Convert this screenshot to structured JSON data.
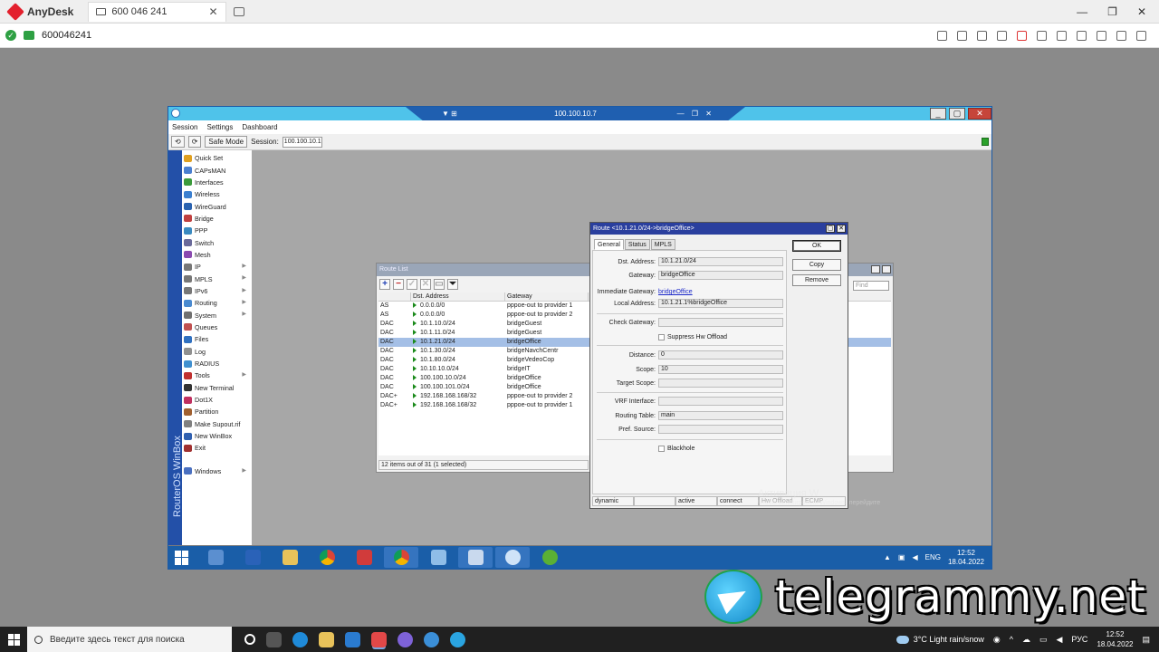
{
  "anydesk": {
    "app_name": "AnyDesk",
    "tab_id": "600 046 241",
    "address_id": "600046241",
    "close_glyph": "✕",
    "win_min": "—",
    "win_max": "❐",
    "win_close": "✕"
  },
  "winbox": {
    "title_ip": "100.100.10.7",
    "menu": [
      "Session",
      "Settings",
      "Dashboard"
    ],
    "toolbar": {
      "safe_mode": "Safe Mode",
      "session_label": "Session:",
      "session_value": "100.100.10.1"
    },
    "brand": "RouterOS WinBox",
    "nav": [
      {
        "label": "Quick Set",
        "color": "#e0a020"
      },
      {
        "label": "CAPsMAN",
        "color": "#4a7fd0"
      },
      {
        "label": "Interfaces",
        "color": "#3b9a3b"
      },
      {
        "label": "Wireless",
        "color": "#3b7fd0"
      },
      {
        "label": "WireGuard",
        "color": "#2a62b0"
      },
      {
        "label": "Bridge",
        "color": "#c04040"
      },
      {
        "label": "PPP",
        "color": "#3a8ac0"
      },
      {
        "label": "Switch",
        "color": "#6a6a9a"
      },
      {
        "label": "Mesh",
        "color": "#8a4ab0"
      },
      {
        "label": "IP",
        "color": "#777777",
        "sub": true
      },
      {
        "label": "MPLS",
        "color": "#777777",
        "sub": true
      },
      {
        "label": "IPv6",
        "color": "#777777",
        "sub": true
      },
      {
        "label": "Routing",
        "color": "#4a8ad0",
        "sub": true
      },
      {
        "label": "System",
        "color": "#707070",
        "sub": true
      },
      {
        "label": "Queues",
        "color": "#c05050"
      },
      {
        "label": "Files",
        "color": "#3070c0"
      },
      {
        "label": "Log",
        "color": "#909090"
      },
      {
        "label": "RADIUS",
        "color": "#4090d0"
      },
      {
        "label": "Tools",
        "color": "#c03030",
        "sub": true
      },
      {
        "label": "New Terminal",
        "color": "#333333"
      },
      {
        "label": "Dot1X",
        "color": "#c03060"
      },
      {
        "label": "Partition",
        "color": "#a06030"
      },
      {
        "label": "Make Supout.rif",
        "color": "#808080"
      },
      {
        "label": "New WinBox",
        "color": "#3060b0"
      },
      {
        "label": "Exit",
        "color": "#a03030"
      }
    ],
    "nav_windows": {
      "label": "Windows",
      "color": "#4a70c0"
    }
  },
  "route_list": {
    "title": "Route List",
    "find_placeholder": "Find",
    "columns": [
      "",
      "Dst. Address",
      "Gateway"
    ],
    "rows": [
      {
        "flag": "AS",
        "dst": "0.0.0.0/0",
        "gw": "pppoe-out  to provider 1"
      },
      {
        "flag": "AS",
        "dst": "0.0.0.0/0",
        "gw": "pppoe-out  to provider 2"
      },
      {
        "flag": "DAC",
        "dst": "10.1.10.0/24",
        "gw": "bridgeGuest"
      },
      {
        "flag": "DAC",
        "dst": "10.1.11.0/24",
        "gw": "bridgeGuest"
      },
      {
        "flag": "DAC",
        "dst": "10.1.21.0/24",
        "gw": "bridgeOffice",
        "selected": true
      },
      {
        "flag": "DAC",
        "dst": "10.1.30.0/24",
        "gw": "bridgeNavchCentr"
      },
      {
        "flag": "DAC",
        "dst": "10.1.80.0/24",
        "gw": "bridgeVedeoCop"
      },
      {
        "flag": "DAC",
        "dst": "10.10.10.0/24",
        "gw": "bridgeIT"
      },
      {
        "flag": "DAC",
        "dst": "100.100.10.0/24",
        "gw": "bridgeOffice"
      },
      {
        "flag": "DAC",
        "dst": "100.100.101.0/24",
        "gw": "bridgeOffice"
      },
      {
        "flag": "DAC+",
        "dst": "192.168.168.168/32",
        "gw": "pppoe-out  to provider 2"
      },
      {
        "flag": "DAC+",
        "dst": "192.168.168.168/32",
        "gw": "pppoe-out  to provider 1"
      }
    ],
    "status": "12 items out of 31 (1 selected)"
  },
  "route_detail": {
    "title": "Route <10.1.21.0/24->bridgeOffice>",
    "tabs": [
      "General",
      "Status",
      "MPLS"
    ],
    "fields": {
      "dst_address": {
        "label": "Dst. Address:",
        "value": "10.1.21.0/24"
      },
      "gateway": {
        "label": "Gateway:",
        "value": "bridgeOffice"
      },
      "immediate_gateway": {
        "label": "Immediate Gateway:",
        "value": "bridgeOffice"
      },
      "local_address": {
        "label": "Local Address:",
        "value": "10.1.21.1%bridgeOffice"
      },
      "check_gateway": {
        "label": "Check Gateway:",
        "value": ""
      },
      "suppress_hw": {
        "label": "Suppress Hw Offload"
      },
      "distance": {
        "label": "Distance:",
        "value": "0"
      },
      "scope": {
        "label": "Scope:",
        "value": "10"
      },
      "target_scope": {
        "label": "Target Scope:",
        "value": ""
      },
      "vrf_interface": {
        "label": "VRF Interface:",
        "value": ""
      },
      "routing_table": {
        "label": "Routing Table:",
        "value": "main"
      },
      "pref_source": {
        "label": "Pref. Source:",
        "value": ""
      },
      "blackhole": {
        "label": "Blackhole"
      }
    },
    "buttons": {
      "ok": "OK",
      "copy": "Copy",
      "remove": "Remove"
    },
    "status": [
      "dynamic",
      "",
      "active",
      "connect",
      "Hw Offload",
      "ECMP"
    ]
  },
  "activation": {
    "line1": "Активация W",
    "line2": "Чтобы активировать Windows, перейдите"
  },
  "remote_taskbar": {
    "lang": "ENG",
    "time": "12:52",
    "date": "18.04.2022"
  },
  "watermark_site": "telegrammy.net",
  "local_taskbar": {
    "search_placeholder": "Введите здесь текст для поиска",
    "weather": "3°C  Light rain/snow",
    "lang": "РУС",
    "time": "12:52",
    "date": "18.04.2022"
  }
}
